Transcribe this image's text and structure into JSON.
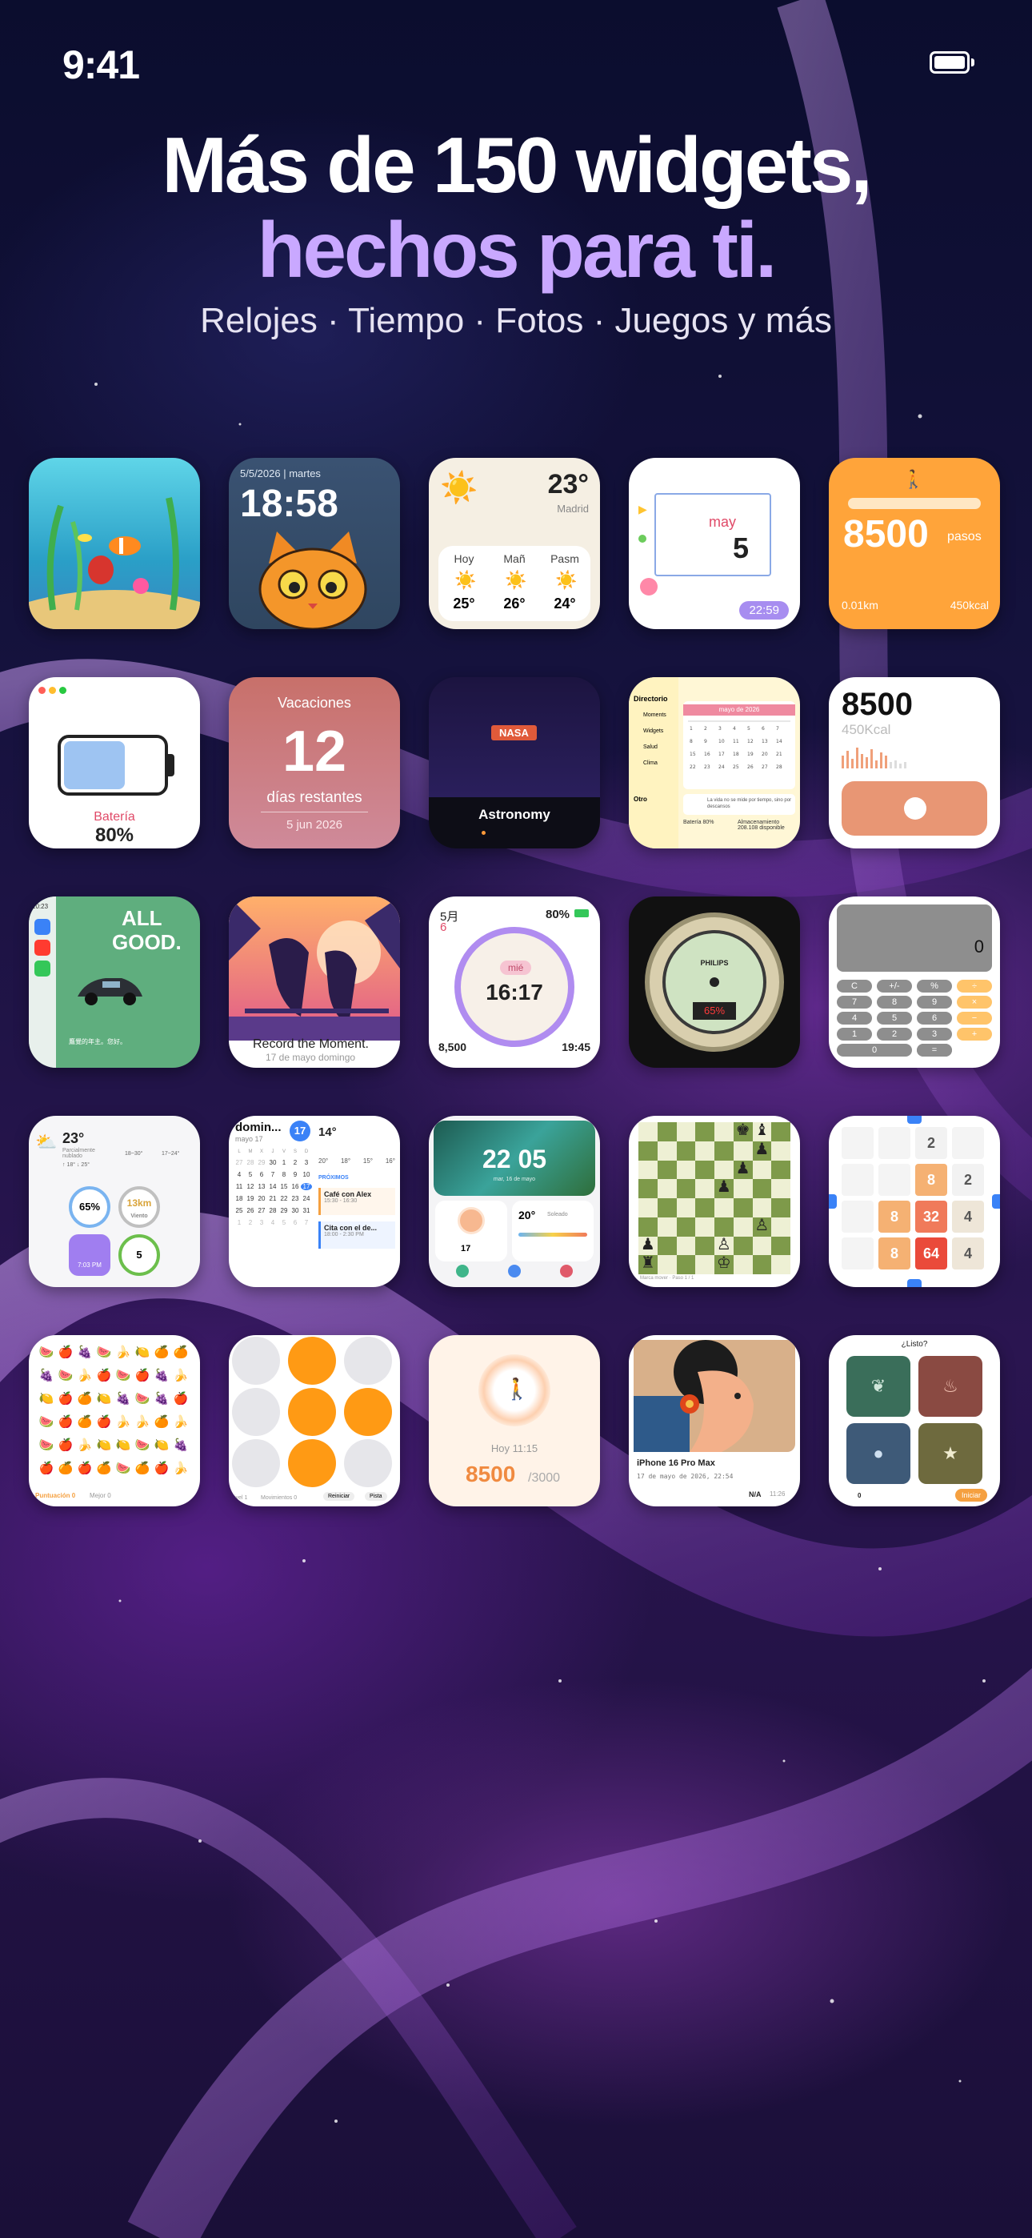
{
  "status_bar": {
    "time": "9:41"
  },
  "headline": {
    "line1": "Más de 150 widgets,",
    "line2": "hechos para ti.",
    "subtitle": "Relojes · Tiempo · Fotos · Juegos y más"
  },
  "widgets": {
    "clock_cat": {
      "date": "5/5/2026 | martes",
      "time": "18:58"
    },
    "weather": {
      "temp": "23°",
      "city": "Madrid",
      "days": [
        "Hoy",
        "Mañ",
        "Pasm"
      ],
      "temps": [
        "25°",
        "26°",
        "24°"
      ]
    },
    "calendar_small": {
      "month": "may",
      "day": "5",
      "time": "22:59"
    },
    "steps": {
      "value": "8500",
      "unit": "pasos",
      "distance": "0.01km",
      "kcal": "450kcal"
    },
    "battery": {
      "label": "Batería",
      "value": "80%"
    },
    "vacation": {
      "title": "Vacaciones",
      "days": "12",
      "remaining": "días restantes",
      "date": "5 jun 2026"
    },
    "nasa": {
      "badge": "NASA",
      "title": "Astronomy"
    },
    "directory": {
      "title": "Directorio",
      "items": [
        "Moments",
        "Widgets",
        "Salud",
        "Clima"
      ],
      "section2": "Otro",
      "calendar_title": "mayo de 2026",
      "note": "La vida no se mide por tiempo, sino por descansos",
      "battery": "Batería 80%",
      "storage": "Almacenamiento 208.108 disponible"
    },
    "kcal": {
      "value": "8500",
      "kcal": "450Kcal"
    },
    "all_good": {
      "line1": "ALL",
      "line2": "GOOD.",
      "time": "10:23",
      "caption": "鷹覺的年主。您好。"
    },
    "parrots": {
      "caption": "Record the Moment.",
      "date": "17 de mayo domingo"
    },
    "ring_clock": {
      "month": "5月",
      "day": "6",
      "battery": "80%",
      "weekday": "mié",
      "time": "16:17",
      "steps": "8,500",
      "sunset": "19:45"
    },
    "gauge": {
      "brand": "PHILIPS",
      "reading": "65%"
    },
    "calculator": {
      "display": "0",
      "keys": [
        "C",
        "+/-",
        "%",
        "÷",
        "7",
        "8",
        "9",
        "×",
        "4",
        "5",
        "6",
        "−",
        "1",
        "2",
        "3",
        "+",
        "0",
        ".",
        "="
      ]
    },
    "weather2": {
      "temp": "23°",
      "desc": "Parcialmente nublado",
      "range": "↑ 18° ↓ 25°",
      "cols": [
        "18~30°",
        "17~24°"
      ],
      "humidity": "65%",
      "wind": "13km",
      "wind_label": "Viento",
      "sunset": "7:03 PM",
      "uv": "5"
    },
    "agenda": {
      "title": "domin...",
      "month": "mayo 17",
      "badge": "17",
      "weekdays": [
        "L",
        "M",
        "X",
        "J",
        "V",
        "S",
        "D"
      ],
      "weeks": [
        [
          "27",
          "28",
          "29",
          "30",
          "1",
          "2",
          "3"
        ],
        [
          "4",
          "5",
          "6",
          "7",
          "8",
          "9",
          "10"
        ],
        [
          "11",
          "12",
          "13",
          "14",
          "15",
          "16",
          "17"
        ],
        [
          "18",
          "19",
          "20",
          "21",
          "22",
          "23",
          "24"
        ],
        [
          "25",
          "26",
          "27",
          "28",
          "29",
          "30",
          "31"
        ],
        [
          "1",
          "2",
          "3",
          "4",
          "5",
          "6",
          "7"
        ]
      ],
      "temp": "14°",
      "forecast": [
        "20°",
        "18°",
        "15°",
        "16°"
      ],
      "events_header": "PRÓXIMOS",
      "event1": "Café con Alex",
      "event1_time": "15:30 - 16:30",
      "event2": "Cita con el de...",
      "event2_time": "18:00 - 2:30 PM"
    },
    "landscape": {
      "time": "22 05",
      "date": "mar, 16 de mayo",
      "steps": "17",
      "temp": "20°",
      "weather": "Soleado"
    },
    "chess": {
      "caption": "Marca mover · Paso 1 / 1"
    },
    "game2048": {
      "tiles": [
        "",
        "",
        "2",
        "",
        "",
        "",
        "8",
        "2",
        "",
        "8",
        "32",
        "4",
        "",
        "8",
        "64",
        "4"
      ]
    },
    "fruits": {
      "score": "Puntuación 0",
      "best": "Mejor 0"
    },
    "dots_game": {
      "level": "Nivel 1",
      "moves": "Movimientos 0",
      "reset": "Reiniciar",
      "hint": "Pista"
    },
    "walk": {
      "time": "Hoy 11:15",
      "steps": "8500",
      "goal": "/3000"
    },
    "portrait": {
      "device": "iPhone 16 Pro Max",
      "date": "17 de mayo de 2026, 22:54",
      "status": "N/A",
      "time": "11:26"
    },
    "ready": {
      "title": "¿Listo?",
      "score": "0",
      "start": "Iniciar"
    }
  },
  "colors": {
    "accent_purple": "#c9a8ff",
    "orange": "#ffa43a"
  }
}
